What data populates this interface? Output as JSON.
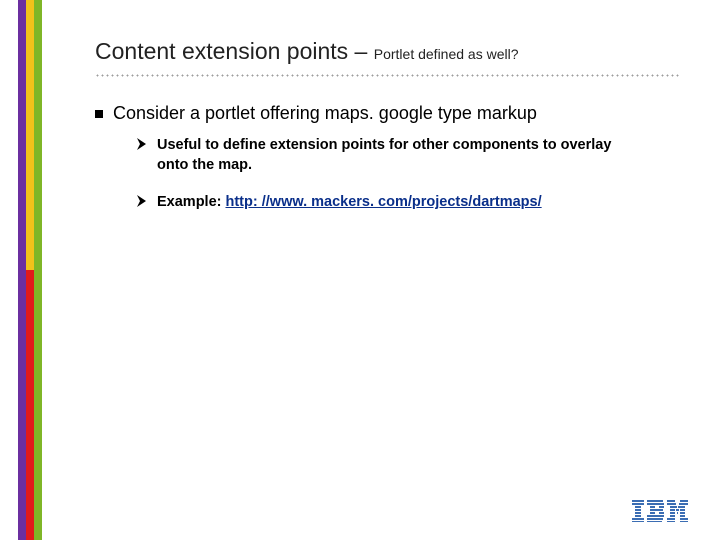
{
  "title": {
    "main": "Content extension points – ",
    "sub": "Portlet defined as well?"
  },
  "bullet1": "Consider a portlet offering maps. google type markup",
  "sub_bullets": [
    {
      "text": "Useful to define extension points for other components to overlay onto the map."
    },
    {
      "prefix": "Example: ",
      "link_text": "http: //www. mackers. com/projects/dartmaps/",
      "link_href": "http://www.mackers.com/projects/dartmaps/"
    }
  ],
  "logo": {
    "name": "IBM"
  }
}
